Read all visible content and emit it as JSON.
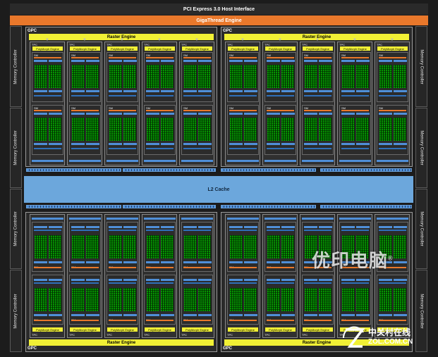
{
  "header": {
    "host_interface": "PCI Express 3.0 Host Interface",
    "gigathread": "GigaThread Engine"
  },
  "memory_controller_label": "Memory Controller",
  "gpc": {
    "label": "GPC",
    "raster_engine": "Raster Engine",
    "tpc_label": "TPC",
    "polymorph_engine": "PolyMorph Engine",
    "sm_label": "SM",
    "tpcs_per_gpc": 5,
    "sms_per_tpc": 2,
    "count": 4
  },
  "l2_cache": "L2 Cache",
  "watermark": {
    "brand_cn": "优印电脑",
    "registered_mark": "®",
    "site_cn": "中关村在线",
    "site_en": "ZOL.COM.CN"
  },
  "colors": {
    "background": "#1c1c1c",
    "host_bar": "#2a2a2a",
    "gigathread": "#e9782b",
    "raster_engine": "#f1f035",
    "polymorph": "#f1f035",
    "cuda_core": "#27c217",
    "register_band": "#4f8fd8",
    "orange_band": "#e9782b",
    "l2_cache": "#6ca7dc",
    "crossbar": "#4f8fd8"
  },
  "icons": [
    "down-arrow-icon",
    "zol-logo-icon"
  ]
}
